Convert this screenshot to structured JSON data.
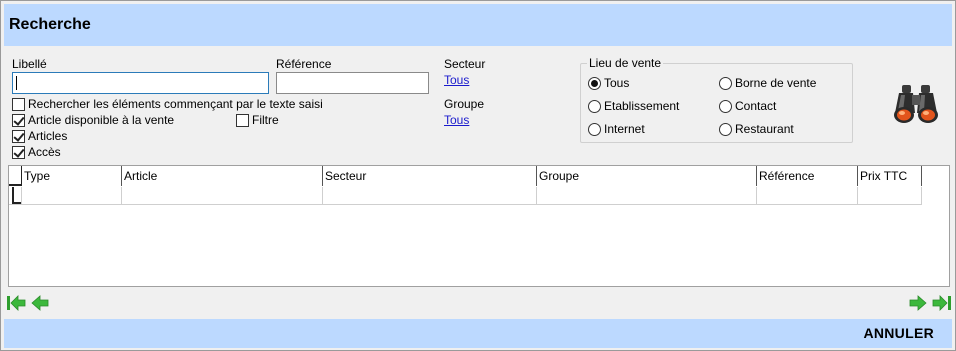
{
  "header": {
    "title": "Recherche"
  },
  "form": {
    "libelle_label": "Libellé",
    "libelle_value": "",
    "reference_label": "Référence",
    "reference_value": "",
    "secteur_label": "Secteur",
    "secteur_link": "Tous",
    "groupe_label": "Groupe",
    "groupe_link": "Tous"
  },
  "checkboxes": [
    {
      "label": "Rechercher les éléments commençant par le texte saisi",
      "checked": false
    },
    {
      "label": "Article disponible à la vente",
      "checked": true
    },
    {
      "label": "Filtre",
      "checked": false
    },
    {
      "label": "Articles",
      "checked": true
    },
    {
      "label": "Accès",
      "checked": true
    }
  ],
  "lieu_de_vente": {
    "legend": "Lieu de vente",
    "options": [
      {
        "label": "Tous",
        "selected": true
      },
      {
        "label": "Borne de vente",
        "selected": false
      },
      {
        "label": "Etablissement",
        "selected": false
      },
      {
        "label": "Contact",
        "selected": false
      },
      {
        "label": "Internet",
        "selected": false
      },
      {
        "label": "Restaurant",
        "selected": false
      }
    ]
  },
  "search_icon": "binoculars-icon",
  "table": {
    "columns": [
      "Type",
      "Article",
      "Secteur",
      "Groupe",
      "Référence",
      "Prix TTC"
    ],
    "rows": []
  },
  "nav": {
    "first": "first-page-icon",
    "prev": "previous-page-icon",
    "next": "next-page-icon",
    "last": "last-page-icon",
    "arrow_color": "#3cb83c"
  },
  "footer": {
    "cancel_label": "ANNULER"
  },
  "colors": {
    "header_bg": "#bcd9ff",
    "link": "#1a1acd",
    "body_bg": "#f0f0f0"
  }
}
